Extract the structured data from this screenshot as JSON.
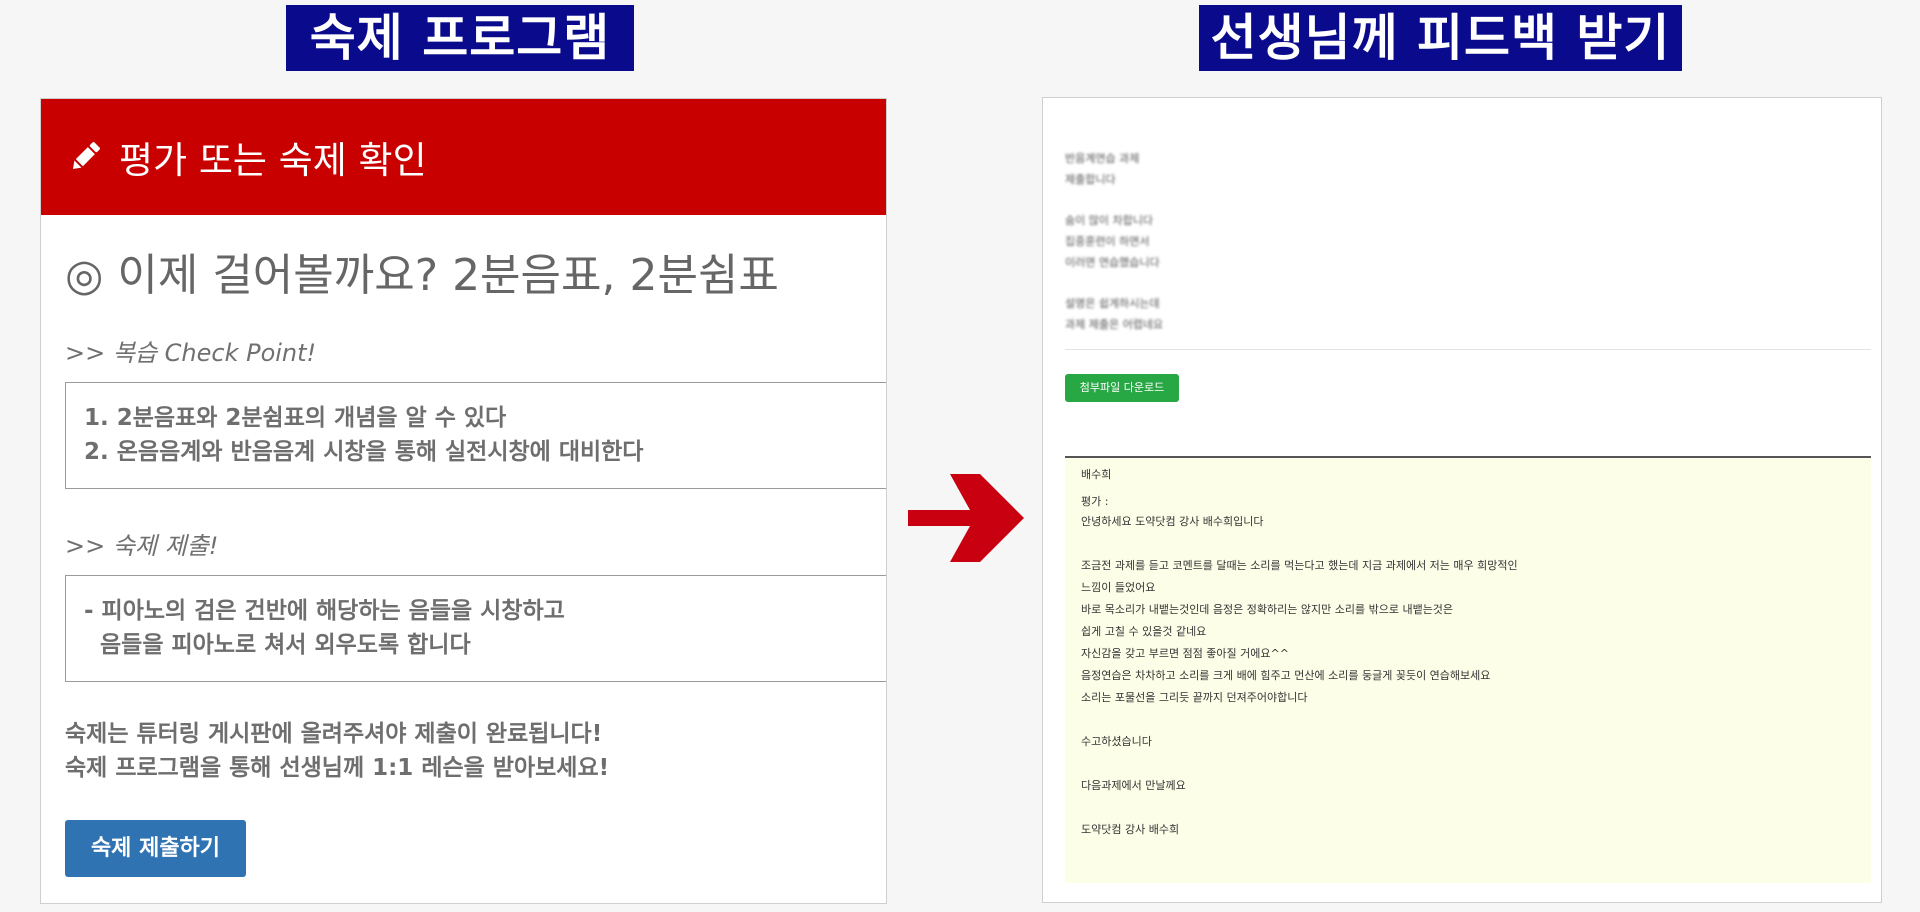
{
  "banners": {
    "left": "숙제 프로그램",
    "right": "선생님께 피드백 받기"
  },
  "left_panel": {
    "header_title": "평가 또는 숙제 확인",
    "header_icon": "pencil-icon",
    "lesson_title": "◎ 이제 걸어볼까요? 2분음표, 2분쉼표",
    "review_label": ">> 복습 Check Point!",
    "review_items": [
      "1. 2분음표와 2분쉼표의 개념을 알 수 있다",
      "2. 온음음계와 반음음계 시창을 통해 실전시창에 대비한다"
    ],
    "homework_label": ">> 숙제 제출!",
    "homework_items": [
      "- 피아노의 검은 건반에 해당하는 음들을 시창하고",
      "  음들을 피아노로 쳐서 외우도록 합니다"
    ],
    "notice_lines": [
      "숙제는 튜터링 게시판에 올려주셔야 제출이 완료됩니다!",
      "숙제 프로그램을 통해 선생님께 1:1 레슨을 받아보세요!"
    ],
    "submit_button": "숙제 제출하기",
    "header_color": "#c80000",
    "button_color": "#2f73b3"
  },
  "right_panel": {
    "blurred_student_text": [
      [
        "반음계연습 과제",
        "제출합니다"
      ],
      [
        "숨이 많이 차합니다",
        "집중훈련이 하면서",
        "이러면 연습했습니다"
      ],
      [
        "설명은 쉽게하시는데",
        "과제 제출은 어렵네요"
      ]
    ],
    "download_button": "첨부파일 다운로드",
    "teacher_name": "배수희",
    "evaluation_label": "평가 :",
    "feedback_lines": [
      "안녕하세요 도약닷컴 강사 배수희입니다",
      "",
      "조금전 과제를 듣고 코멘트를 달때는 소리를 먹는다고 했는데 지금 과제에서 저는 매우 희망적인",
      "느낌이 들었어요",
      "바로 목소리가 내뱉는것인데 음정은 정확하리는 않지만 소리를 밖으로 내뱉는것은",
      "쉽게 고칠 수 있을것 같네요",
      "자신감을 갖고 부르면 점점 좋아질 거에요^^",
      "음정연습은 차차하고 소리를 크게 배에 힘주고 먼산에 소리를 둥글게 꽂듯이 연습해보세요",
      "소리는 포물선을 그리듯 끝까지 던져주어야합니다",
      "",
      "수고하셨습니다",
      "",
      "다음과제에서 만날께요",
      "",
      "도약닷컴 강사 배수희"
    ],
    "feedback_bg": "#fdfee8",
    "download_color": "#28a745"
  },
  "arrow_icon": "right-arrow-icon",
  "arrow_color": "#c8000f"
}
